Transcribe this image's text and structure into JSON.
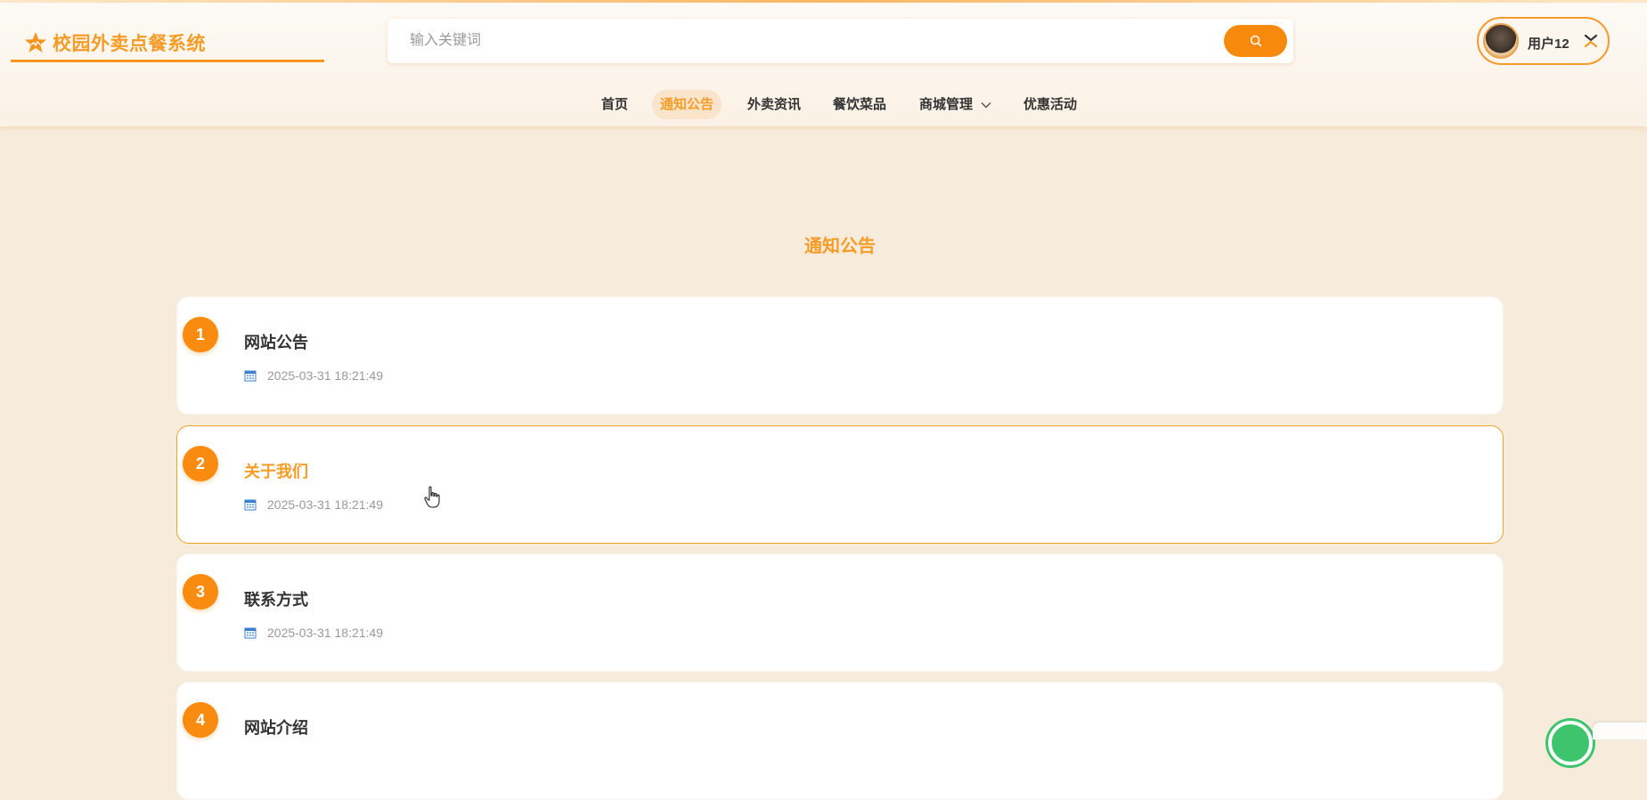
{
  "header": {
    "logo_text": "校园外卖点餐系统",
    "search_placeholder": "输入关键词",
    "user_name": "用户12"
  },
  "nav": {
    "items": [
      {
        "label": "首页",
        "active": false
      },
      {
        "label": "通知公告",
        "active": true
      },
      {
        "label": "外卖资讯",
        "active": false
      },
      {
        "label": "餐饮菜品",
        "active": false
      },
      {
        "label": "商城管理",
        "active": false,
        "has_dropdown": true
      },
      {
        "label": "优惠活动",
        "active": false
      }
    ]
  },
  "main": {
    "title": "通知公告",
    "notices": [
      {
        "index": "1",
        "title": "网站公告",
        "date": "2025-03-31 18:21:49"
      },
      {
        "index": "2",
        "title": "关于我们",
        "date": "2025-03-31 18:21:49",
        "hovered": true
      },
      {
        "index": "3",
        "title": "联系方式",
        "date": "2025-03-31 18:21:49"
      },
      {
        "index": "4",
        "title": "网站介绍",
        "date": ""
      }
    ]
  },
  "colors": {
    "accent": "#f59c27",
    "button": "#f78a0c",
    "background": "#f7ebdc",
    "date_icon": "#3b7fd0"
  },
  "icons": {
    "logo": "star-icon",
    "search": "search-icon",
    "user_menu": "collapse-icon",
    "dropdown": "chevron-down-icon",
    "date": "calendar-icon"
  }
}
